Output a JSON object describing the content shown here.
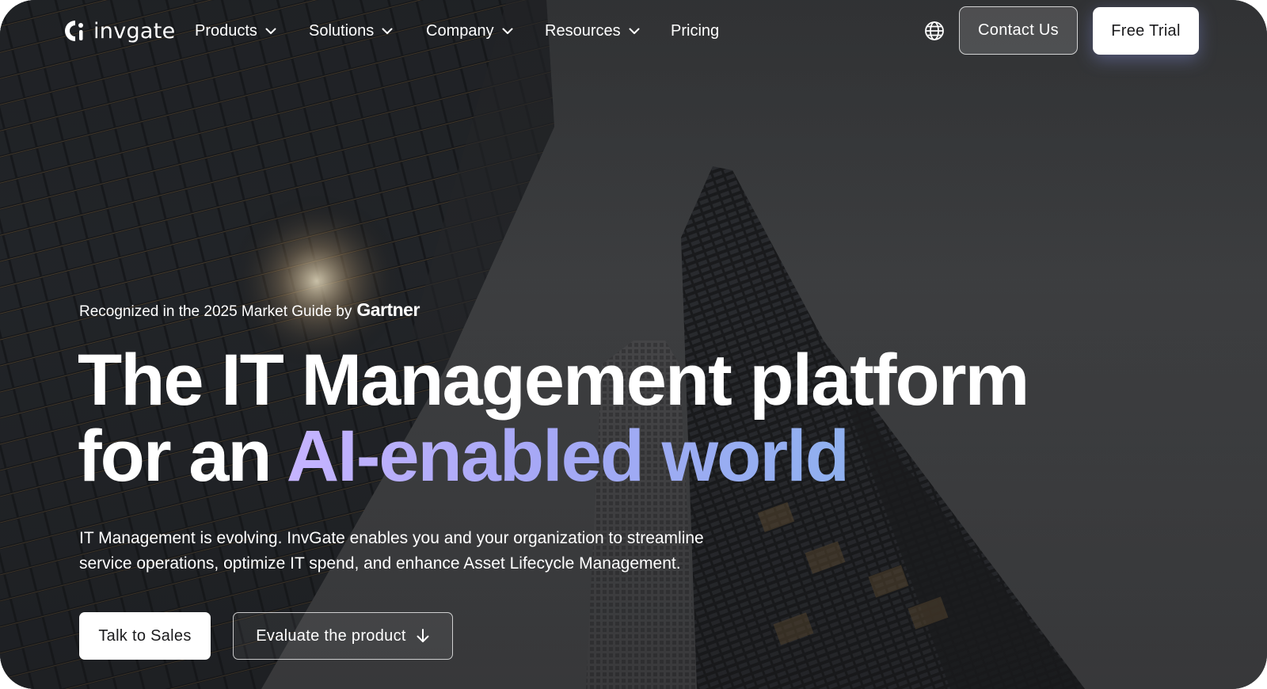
{
  "brand": {
    "name": "invgate",
    "logo_icon": "invgate-logo-icon"
  },
  "nav": {
    "items": [
      {
        "label": "Products",
        "has_dropdown": true
      },
      {
        "label": "Solutions",
        "has_dropdown": true
      },
      {
        "label": "Company",
        "has_dropdown": true
      },
      {
        "label": "Resources",
        "has_dropdown": true
      },
      {
        "label": "Pricing",
        "has_dropdown": false
      }
    ],
    "language_icon": "globe-icon",
    "contact_label": "Contact Us",
    "trial_label": "Free Trial"
  },
  "hero": {
    "eyebrow": "Recognized in the 2025 Market Guide by",
    "eyebrow_brand": "Gartner",
    "headline_line1": "The IT Management platform",
    "headline_prefix": "for an",
    "headline_highlight": "AI-enabled world",
    "description_line1": "IT Management is evolving. InvGate enables you and your organization to streamline",
    "description_line2": "service operations, optimize IT spend, and enhance Asset Lifecycle Management.",
    "primary_cta": "Talk to Sales",
    "secondary_cta": "Evaluate the product",
    "secondary_cta_icon": "arrow-down-icon"
  },
  "colors": {
    "background": "#3e4042",
    "text": "#ffffff",
    "highlight_gradient_start": "#c6b4ff",
    "highlight_gradient_end": "#8fb0ef",
    "button_light": "#ffffff",
    "button_dark_text": "#1b1b1d"
  }
}
